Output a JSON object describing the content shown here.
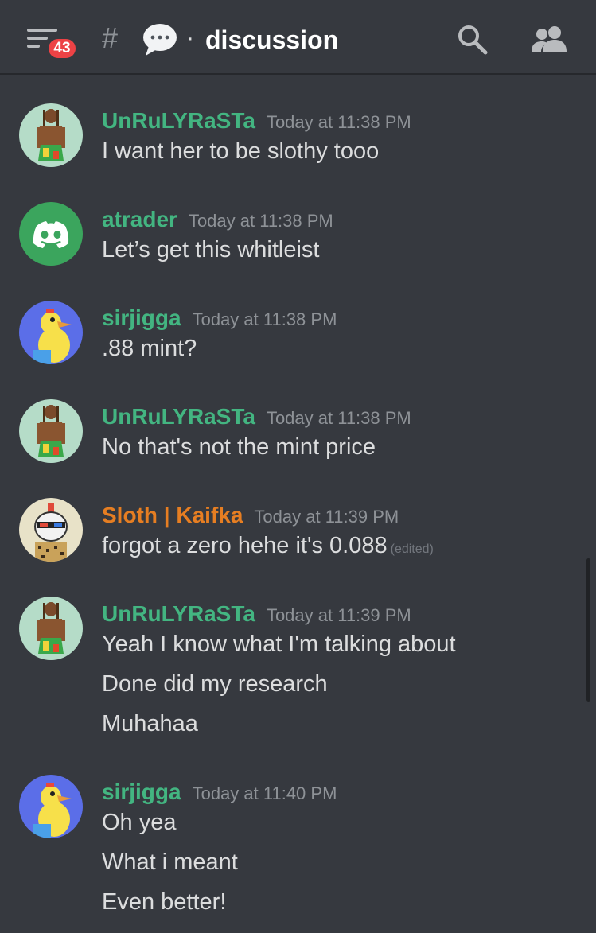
{
  "header": {
    "notification_count": "43",
    "channel_prefix": "#",
    "separator": "·",
    "channel_name": "discussion",
    "icons": [
      "menu-icon",
      "speech-bubble-icon",
      "search-icon",
      "members-icon"
    ]
  },
  "colors": {
    "background": "#36393f",
    "username_green": "#43b581",
    "username_orange": "#e67e22",
    "badge_red": "#ed4245"
  },
  "messages": [
    {
      "username": "UnRuLYRaSTa",
      "timestamp": "Today at 11:38 PM",
      "lines": [
        "I want her to be slothy tooo"
      ]
    },
    {
      "username": "atrader",
      "timestamp": "Today at 11:38 PM",
      "lines": [
        "Let’s get this whitleist"
      ]
    },
    {
      "username": "sirjigga",
      "timestamp": "Today at 11:38 PM",
      "lines": [
        ".88 mint?"
      ]
    },
    {
      "username": "UnRuLYRaSTa",
      "timestamp": "Today at 11:38 PM",
      "lines": [
        "No that's not the mint price"
      ]
    },
    {
      "username": "Sloth | Kaifka",
      "timestamp": "Today at 11:39 PM",
      "lines": [
        "forgot a zero hehe it's 0.088"
      ],
      "edited": "(edited)"
    },
    {
      "username": "UnRuLYRaSTa",
      "timestamp": "Today at 11:39 PM",
      "lines": [
        "Yeah I know what I'm talking about",
        "Done did my research",
        "Muhahaa"
      ]
    },
    {
      "username": "sirjigga",
      "timestamp": "Today at 11:40 PM",
      "lines": [
        "Oh yea",
        "What i meant",
        "Even better!"
      ]
    }
  ]
}
